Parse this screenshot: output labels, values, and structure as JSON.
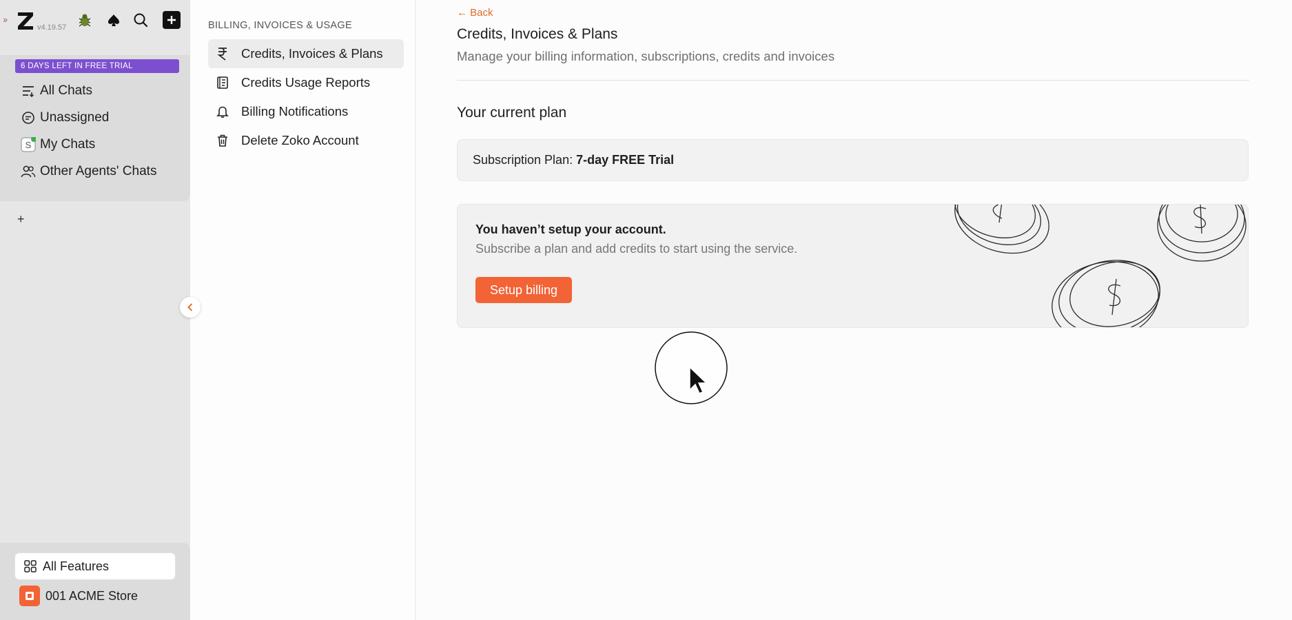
{
  "sidebar": {
    "version": "v4.19.57",
    "trial_banner": "6 DAYS LEFT IN FREE TRIAL",
    "nav": [
      {
        "label": "All Chats",
        "icon": "list-filter-icon"
      },
      {
        "label": "Unassigned",
        "icon": "chat-bubble-icon"
      },
      {
        "label": "My Chats",
        "icon": "s-badge-icon"
      },
      {
        "label": "Other Agents' Chats",
        "icon": "users-icon"
      }
    ],
    "add_label": "+",
    "all_features": "All Features",
    "store_name": "001 ACME Store"
  },
  "settings": {
    "section_title": "BILLING, INVOICES & USAGE",
    "items": [
      {
        "label": "Credits, Invoices & Plans",
        "icon": "rupee-icon"
      },
      {
        "label": "Credits Usage Reports",
        "icon": "report-icon"
      },
      {
        "label": "Billing Notifications",
        "icon": "bell-icon"
      },
      {
        "label": "Delete Zoko Account",
        "icon": "trash-icon"
      }
    ]
  },
  "main": {
    "back_label": "← Back",
    "title": "Credits, Invoices & Plans",
    "subtitle": "Manage your billing information, subscriptions, credits and invoices",
    "current_plan_heading": "Your current plan",
    "plan_label": "Subscription Plan:",
    "plan_value": "7-day FREE Trial",
    "setup_heading": "You haven’t setup your account.",
    "setup_subtext": "Subscribe a plan and add credits to start using the service.",
    "setup_button": "Setup billing"
  },
  "colors": {
    "accent": "#f26336",
    "trial_banner": "#7c4fcf",
    "link": "#e26a2c"
  }
}
